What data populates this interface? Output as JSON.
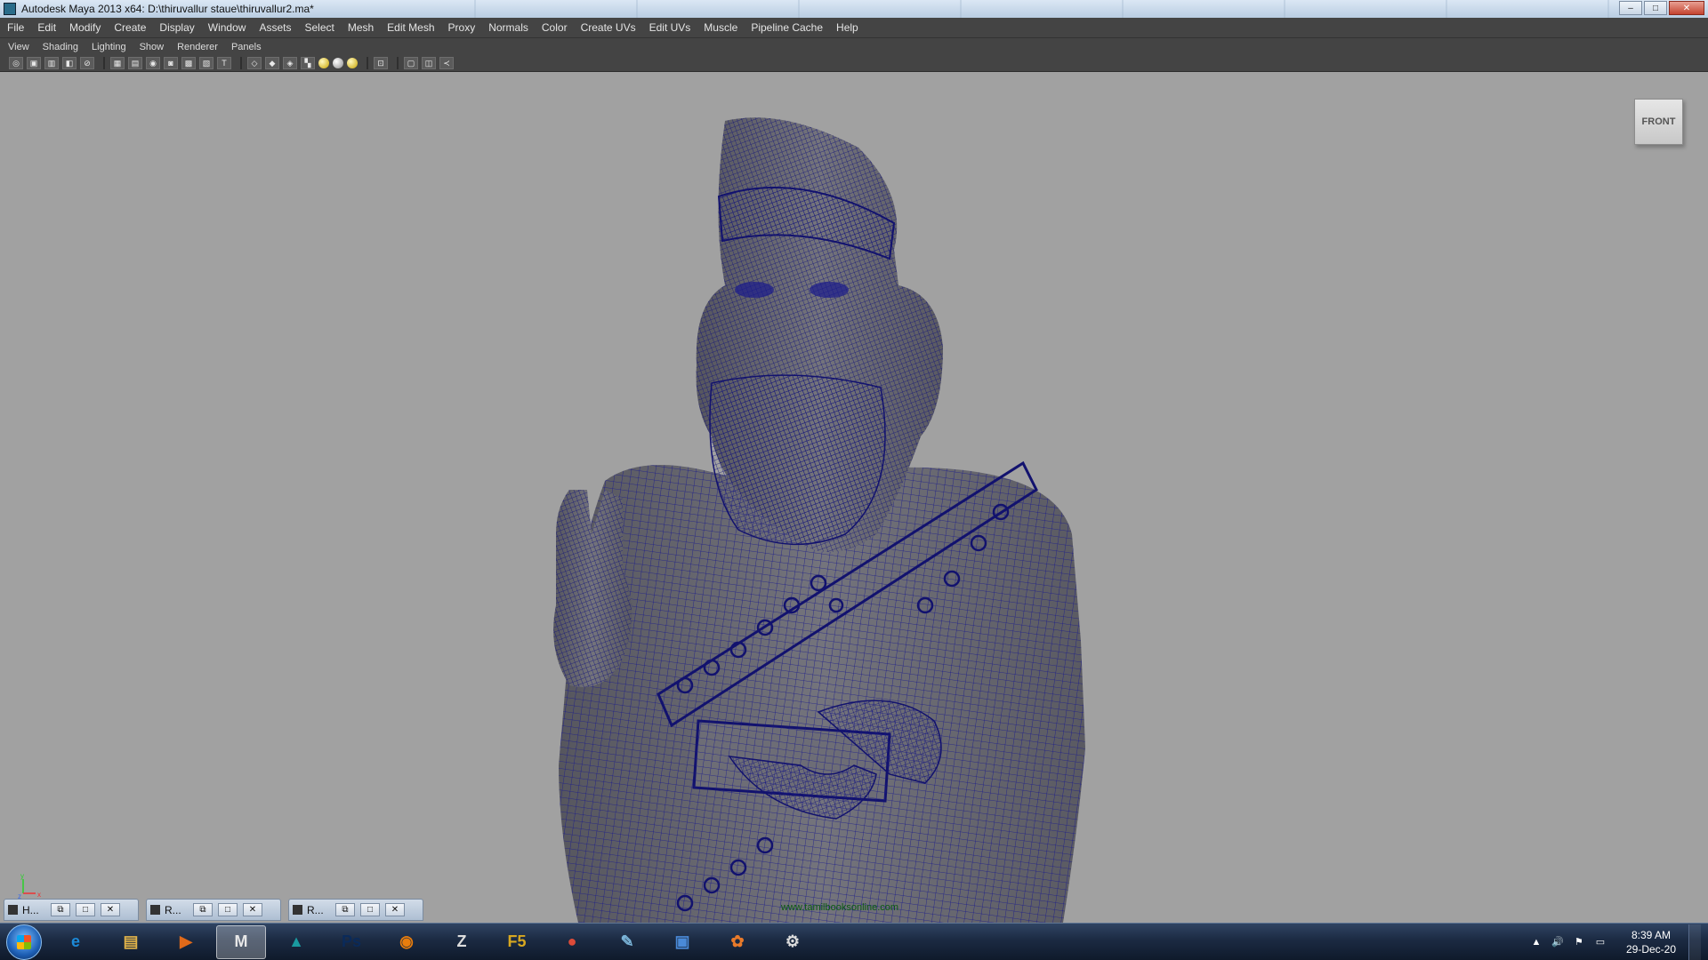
{
  "window": {
    "title": "Autodesk Maya 2013 x64: D:\\thiruvallur staue\\thiruvallur2.ma*",
    "minimize": "‒",
    "maximize": "□",
    "close": "✕"
  },
  "menubar": [
    "File",
    "Edit",
    "Modify",
    "Create",
    "Display",
    "Window",
    "Assets",
    "Select",
    "Mesh",
    "Edit Mesh",
    "Proxy",
    "Normals",
    "Color",
    "Create UVs",
    "Edit UVs",
    "Muscle",
    "Pipeline Cache",
    "Help"
  ],
  "panel_menu": [
    "View",
    "Shading",
    "Lighting",
    "Show",
    "Renderer",
    "Panels"
  ],
  "viewport": {
    "view_cube_label": "FRONT",
    "axis_labels": {
      "y": "y",
      "z": "z",
      "x": "x"
    },
    "watermark": "www.tamilbooksonline.com"
  },
  "minimized_windows": [
    {
      "label": "H...",
      "restore": "⧉",
      "maximize": "□",
      "close": "✕"
    },
    {
      "label": "R...",
      "restore": "⧉",
      "maximize": "□",
      "close": "✕"
    },
    {
      "label": "R...",
      "restore": "⧉",
      "maximize": "□",
      "close": "✕"
    }
  ],
  "taskbar": {
    "apps": [
      {
        "name": "Internet Explorer",
        "glyph": "e",
        "color": "#1c8ad8"
      },
      {
        "name": "Windows Explorer",
        "glyph": "▤",
        "color": "#e2b44a"
      },
      {
        "name": "Media Player",
        "glyph": "▶",
        "color": "#e06a1a"
      },
      {
        "name": "Maya",
        "glyph": "M",
        "color": "#e8e8e8",
        "active": true
      },
      {
        "name": "Mudbox",
        "glyph": "▲",
        "color": "#1a9aa0"
      },
      {
        "name": "Photoshop",
        "glyph": "Ps",
        "color": "#0a2a5a"
      },
      {
        "name": "Blender",
        "glyph": "◉",
        "color": "#e87d0d"
      },
      {
        "name": "ZBrush",
        "glyph": "Z",
        "color": "#dddddd"
      },
      {
        "name": "F5",
        "glyph": "F5",
        "color": "#d8a820"
      },
      {
        "name": "Chrome",
        "glyph": "●",
        "color": "#dd4b39"
      },
      {
        "name": "Notepad",
        "glyph": "✎",
        "color": "#7ab4d8"
      },
      {
        "name": "Screen Capture",
        "glyph": "▣",
        "color": "#4a8ad8"
      },
      {
        "name": "Paint",
        "glyph": "✿",
        "color": "#e87a2a"
      },
      {
        "name": "Tools",
        "glyph": "⚙",
        "color": "#dddddd"
      }
    ],
    "tray": {
      "show_hidden": "▲",
      "volume": "🔊",
      "flag": "⚑",
      "network": "▭"
    },
    "time": "8:39 AM",
    "date": "29-Dec-20"
  },
  "colors": {
    "viewport_bg": "#a1a1a1",
    "wireframe": "#1a1a8c",
    "mesh_shade": "#6a6a72",
    "ui_dark": "#444444"
  }
}
